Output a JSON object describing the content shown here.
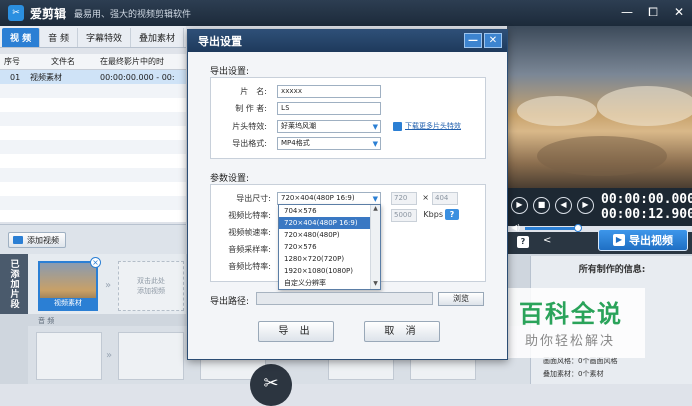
{
  "app": {
    "logo_glyph": "✂",
    "name": "爱剪辑",
    "slogan": "最易用、强大的视频剪辑软件",
    "window_controls": [
      "—",
      "⧠",
      "✕"
    ]
  },
  "tabs": [
    {
      "label": "视 频",
      "active": true
    },
    {
      "label": "音 频",
      "active": false
    },
    {
      "label": "字幕特效",
      "active": false
    },
    {
      "label": "叠加素材",
      "active": false
    }
  ],
  "list": {
    "headers": [
      "序号",
      "文件名",
      "在最终影片中的时"
    ],
    "rows": [
      {
        "index": "01",
        "name": "视频素材",
        "time": "00:00:00.000 - 00:"
      }
    ]
  },
  "add_video_label": "添加视频",
  "timeline": {
    "side_label": "已添加片段",
    "clip_label": "视频素材",
    "placeholder_label": "双击此处\n添加视频",
    "audio_label": "音 频",
    "arrow": "»",
    "scissors_glyph": "✂"
  },
  "player": {
    "current_time": "00:00:00.000",
    "total_time": "00:00:12.900",
    "play_glyph": "▶",
    "stop_glyph": "■",
    "prev_glyph": "◀",
    "next_glyph": "▶",
    "volume_glyph": "◀)",
    "help_glyph": "?",
    "share_glyph": "<",
    "volume_level": 0.88
  },
  "export_video_button": "导出视频",
  "info_panel": {
    "title": "所有制作的信息:",
    "lines": [
      "画面风格：0个画面风格",
      "叠加素材：0个素材"
    ]
  },
  "watermark": {
    "main": "百科全说",
    "sub": "助你轻松解决"
  },
  "dialog": {
    "title": "导出设置",
    "controls": [
      "—",
      "✕"
    ],
    "export_section": "导出设置:",
    "fields": {
      "title_label": "片　名:",
      "title_value": "xxxxx",
      "author_label": "制 作 者:",
      "author_value": "LS",
      "intro_label": "片头特效:",
      "intro_value": "好莱坞风潮",
      "format_label": "导出格式:",
      "format_value": "MP4格式",
      "more_intro_link": "下载更多片头特效"
    },
    "params_section": "参数设置:",
    "params": {
      "size_label": "导出尺寸:",
      "size_value": "720×404(480P 16:9)",
      "width_value": "720",
      "height_value": "404",
      "times": "×",
      "bitrate_label": "视频比特率:",
      "bitrate_value": "5000",
      "bitrate_unit": "Kbps",
      "help_glyph": "?",
      "framerate_label": "视频帧速率:",
      "audio_sample_label": "音频采样率:",
      "audio_bitrate_label": "音频比特率:"
    },
    "size_options": [
      {
        "label": "704×576",
        "selected": false
      },
      {
        "label": "720×404(480P 16:9)",
        "selected": true
      },
      {
        "label": "720×480(480P)",
        "selected": false
      },
      {
        "label": "720×576",
        "selected": false
      },
      {
        "label": "1280×720(720P)",
        "selected": false
      },
      {
        "label": "1920×1080(1080P)",
        "selected": false
      },
      {
        "label": "自定义分辨率",
        "selected": false
      }
    ],
    "path_label": "导出路径:",
    "browse_label": "浏览",
    "export_button": "导 出",
    "cancel_button": "取 消"
  },
  "colors": {
    "accent": "#2b7fd4",
    "titlebar": "#1e3a5c",
    "watermark_green": "#2aa35a"
  }
}
